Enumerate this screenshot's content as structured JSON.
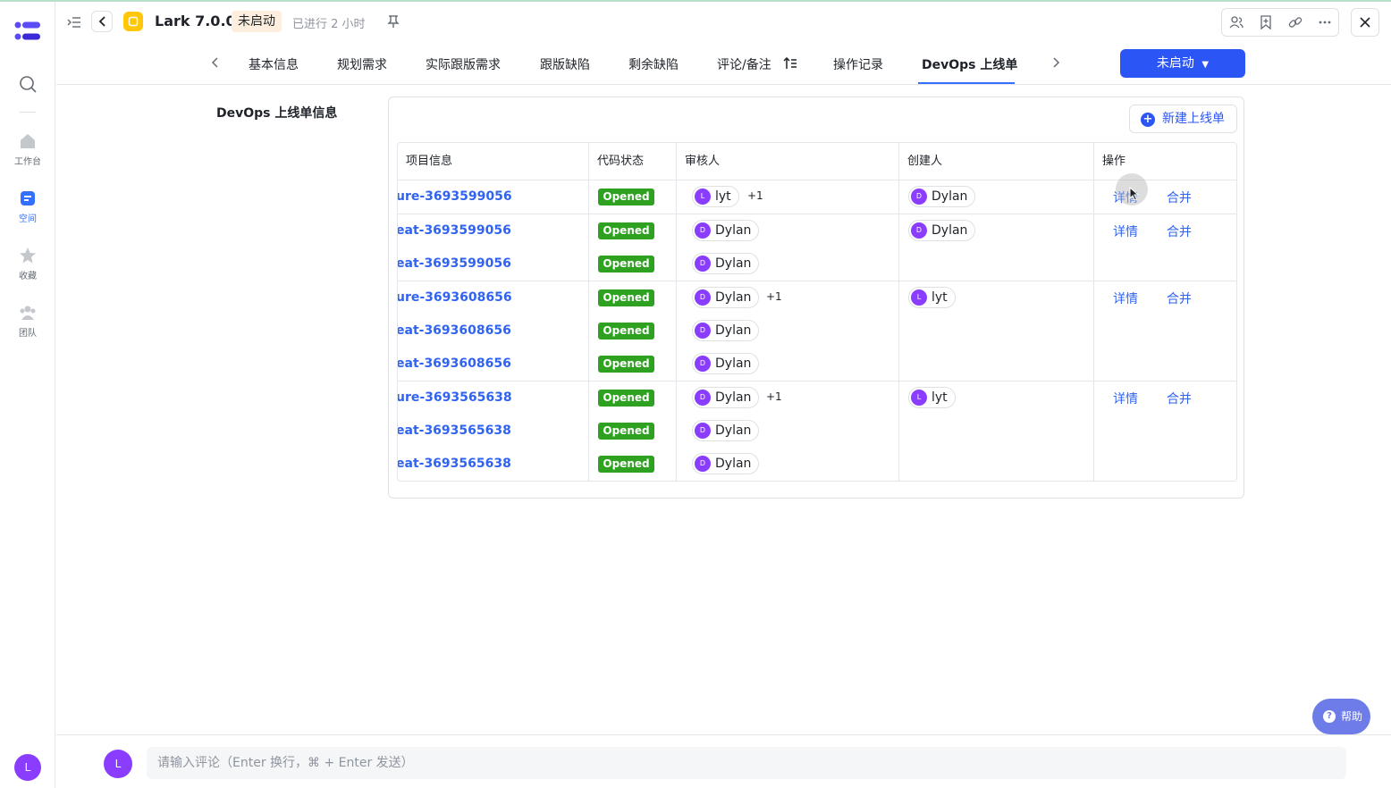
{
  "rail": {
    "items": [
      {
        "label": "工作台",
        "icon": "home-icon"
      },
      {
        "label": "空间",
        "icon": "space-icon"
      },
      {
        "label": "收藏",
        "icon": "star-icon"
      },
      {
        "label": "团队",
        "icon": "team-icon"
      }
    ],
    "avatar": "L"
  },
  "header": {
    "title": "Lark 7.0.0",
    "status": "未启动",
    "elapsed": "已进行 2 小时"
  },
  "tabs": [
    "基本信息",
    "规划需求",
    "实际跟版需求",
    "跟版缺陷",
    "剩余缺陷",
    "评论/备注",
    "操作记录",
    "DevOps 上线单"
  ],
  "status_button": "未启动",
  "section_title": "DevOps 上线单信息",
  "new_button": "新建上线单",
  "table": {
    "headers": [
      "项目信息",
      "代码状态",
      "审核人",
      "创建人",
      "操作"
    ],
    "rows": [
      {
        "project": "ure-3693599056",
        "status": "Opened",
        "reviewer": "lyt",
        "reviewer_initial": "L",
        "reviewer_extra": "+1"
      },
      {
        "project": "eat-3693599056",
        "status": "Opened",
        "reviewer": "Dylan",
        "reviewer_initial": "D"
      },
      {
        "project": "eat-3693599056",
        "status": "Opened",
        "reviewer": "Dylan",
        "reviewer_initial": "D"
      },
      {
        "project": "ure-3693608656",
        "status": "Opened",
        "reviewer": "Dylan",
        "reviewer_initial": "D",
        "reviewer_extra": "+1"
      },
      {
        "project": "eat-3693608656",
        "status": "Opened",
        "reviewer": "Dylan",
        "reviewer_initial": "D"
      },
      {
        "project": "eat-3693608656",
        "status": "Opened",
        "reviewer": "Dylan",
        "reviewer_initial": "D"
      },
      {
        "project": "ure-3693565638",
        "status": "Opened",
        "reviewer": "Dylan",
        "reviewer_initial": "D",
        "reviewer_extra": "+1"
      },
      {
        "project": "eat-3693565638",
        "status": "Opened",
        "reviewer": "Dylan",
        "reviewer_initial": "D"
      },
      {
        "project": "eat-3693565638",
        "status": "Opened",
        "reviewer": "Dylan",
        "reviewer_initial": "D"
      }
    ],
    "groups": [
      {
        "creator": "Dylan",
        "creator_initial": "D",
        "actions": [
          "详情",
          "合并"
        ]
      },
      {
        "creator": "Dylan",
        "creator_initial": "D",
        "actions": [
          "详情",
          "合并"
        ]
      },
      {
        "creator": "lyt",
        "creator_initial": "L",
        "actions": [
          "详情",
          "合并"
        ]
      },
      {
        "creator": "lyt",
        "creator_initial": "L",
        "actions": [
          "详情",
          "合并"
        ]
      }
    ]
  },
  "help_button": "帮助",
  "comment": {
    "avatar": "L",
    "placeholder": "请输入评论（Enter 换行，⌘ + Enter 发送）"
  },
  "colors": {
    "primary": "#2c55f5",
    "link": "#3064f0",
    "status_open": "#2ea121",
    "avatar": "#8b3dff",
    "status_tag_bg": "#fdeedd"
  }
}
